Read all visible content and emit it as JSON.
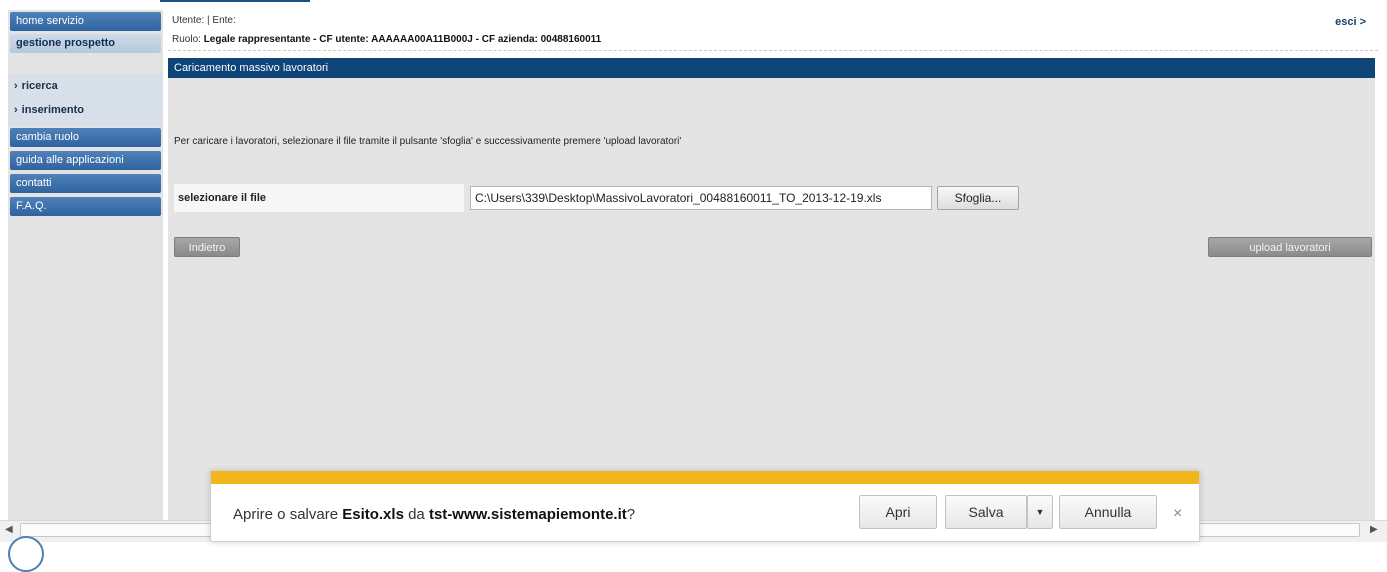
{
  "sidebar": {
    "home": "home servizio",
    "gestione": "gestione prospetto",
    "ricerca": "ricerca",
    "inserimento": "inserimento",
    "cambia_ruolo": "cambia ruolo",
    "guida": "guida alle applicazioni",
    "contatti": "contatti",
    "faq": "F.A.Q."
  },
  "header": {
    "line1": "Utente: | Ente:",
    "ruolo_prefix": "Ruolo:",
    "ruolo_value": "Legale rappresentante - CF utente: AAAAAA00A11B000J - CF azienda: 00488160011",
    "esci": "esci >"
  },
  "main": {
    "title": "Caricamento massivo lavoratori",
    "instructions": "Per caricare i lavoratori, selezionare il file tramite il pulsante 'sfoglia' e successivamente premere 'upload lavoratori'",
    "file_label": "selezionare il file",
    "file_value": "C:\\Users\\339\\Desktop\\MassivoLavoratori_00488160011_TO_2013-12-19.xls",
    "browse_label": "Sfoglia...",
    "back_label": "Indietro",
    "upload_label": "upload lavoratori"
  },
  "download_bar": {
    "prefix": "Aprire o salvare",
    "filename": "Esito.xls",
    "from": "da",
    "site": "tst-www.sistemapiemonte.it",
    "suffix": "?",
    "open_label": "Apri",
    "save_label": "Salva",
    "cancel_label": "Annulla",
    "close_glyph": "×",
    "dropdown_glyph": "▼"
  },
  "colors": {
    "nav_blue": "#2f63a0",
    "title_bar": "#0f4478",
    "download_accent": "#f2b51c"
  }
}
